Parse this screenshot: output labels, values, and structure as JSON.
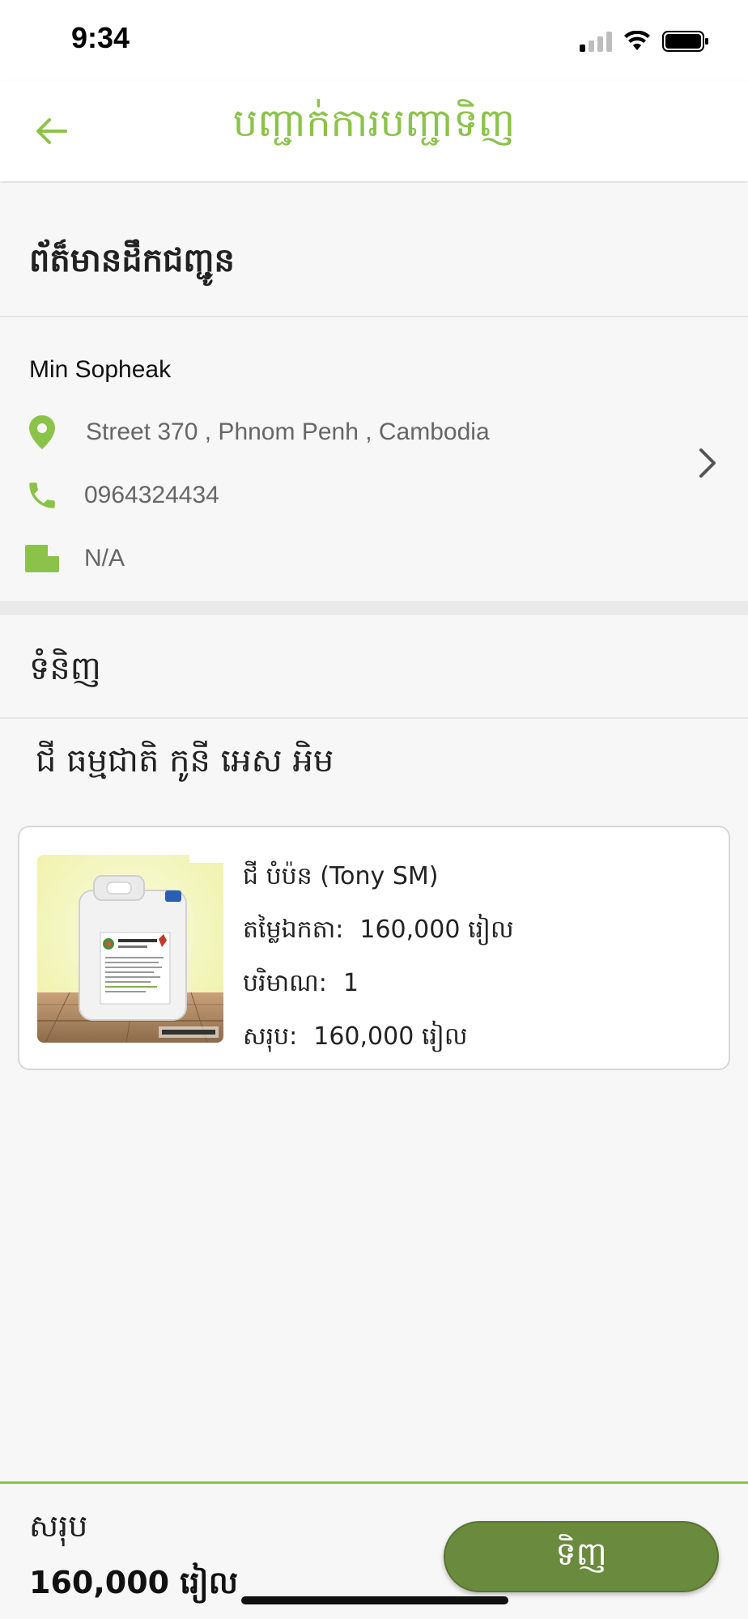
{
  "status_bar": {
    "time": "9:34"
  },
  "header": {
    "title": "បញ្ជាក់ការបញ្ជាទិញ"
  },
  "delivery": {
    "heading": "ព័ត៏មានដឹកជញ្ជូន",
    "name": "Min Sopheak",
    "address": "Street 370 , Phnom Penh , Cambodia",
    "phone": "0964324434",
    "note": "N/A"
  },
  "products": {
    "heading": "ទំនិញ",
    "category": "ជី ធម្មជាតិ កូនី អេស អិម",
    "items": [
      {
        "name": "ជី បំប៉ន (Tony SM)",
        "unit_price_label": "តម្លៃឯកតា:",
        "unit_price": "160,000 រៀល",
        "quantity_label": "បរិមាណ:",
        "quantity": "1",
        "subtotal_label": "សរុប:",
        "subtotal": "160,000 រៀល"
      }
    ]
  },
  "summary": {
    "total_label": "សរុប",
    "total_value": "160,000 រៀល",
    "buy_label": "ទិញ"
  },
  "colors": {
    "accent": "#8bc34a",
    "button": "#6a8a3d"
  },
  "icons": [
    "back-arrow-icon",
    "location-pin-icon",
    "phone-icon",
    "note-icon",
    "chevron-right-icon"
  ]
}
